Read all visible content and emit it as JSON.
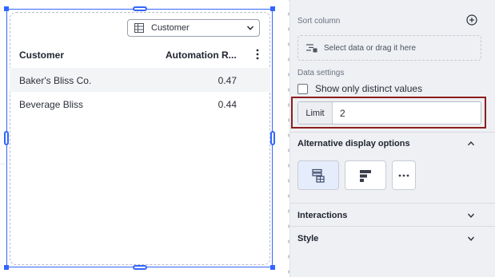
{
  "canvas": {
    "dropdown": {
      "label": "Customer",
      "icon": "table-icon"
    },
    "table": {
      "columns": [
        "Customer",
        "Automation R..."
      ],
      "rows": [
        [
          "Baker's Bliss Co.",
          "0.47"
        ],
        [
          "Beverage Bliss",
          "0.44"
        ]
      ]
    }
  },
  "panel": {
    "sort_column_label": "Sort column",
    "drop_zone_text": "Select data or drag it here",
    "data_settings_label": "Data settings",
    "distinct_label": "Show only distinct values",
    "distinct_checked": false,
    "limit_label": "Limit",
    "limit_value": "2",
    "alt_display_title": "Alternative display options",
    "interactions_title": "Interactions",
    "style_title": "Style"
  },
  "colors": {
    "selection": "#3366ff",
    "highlight": "#8b1e1e",
    "active_option": "#e5ecfb"
  }
}
